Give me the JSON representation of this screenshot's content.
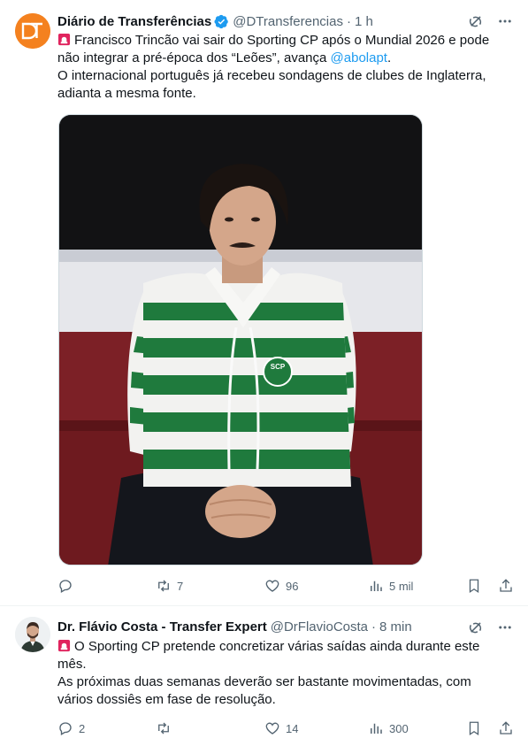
{
  "tweets": [
    {
      "author": {
        "display_name": "Diário de Transferências",
        "handle": "@DTransferencias",
        "verified": true,
        "avatar_text": "DT"
      },
      "time": "1 h",
      "text_parts": {
        "line1_before": "Francisco Trincão vai sair do Sporting CP após o Mundial 2026 e pode não integrar a pré-época dos “Leões”, avança ",
        "mention": "@abolapt",
        "line1_after": ".",
        "line2": "O internacional português já recebeu sondagens de clubes de Inglaterra, adianta a mesma fonte."
      },
      "media": {
        "crest_text": "SCP"
      },
      "stats": {
        "replies": "",
        "retweets": "7",
        "likes": "96",
        "views": "5 mil"
      }
    },
    {
      "author": {
        "display_name": "Dr. Flávio Costa - Transfer Expert",
        "handle": "@DrFlavioCosta",
        "verified": false
      },
      "time": "8 min",
      "text_parts": {
        "line1": "O Sporting CP pretende concretizar várias saídas ainda durante este mês.",
        "line2": "As próximas duas semanas deverão ser bastante movimentadas, com vários dossiês em fase de resolução."
      },
      "stats": {
        "replies": "2",
        "retweets": "",
        "likes": "14",
        "views": "300"
      }
    }
  ],
  "separator": "·",
  "colors": {
    "text_primary": "#0f1419",
    "text_secondary": "#536471",
    "link": "#1d9bf0",
    "verified": "#1d9bf0",
    "avatar_orange": "#f4811f",
    "sporting_green": "#1f7a3d"
  },
  "icons": {
    "grok": "grok-icon",
    "more": "more-icon",
    "siren": "siren-icon",
    "reply": "reply-icon",
    "retweet": "retweet-icon",
    "like": "heart-icon",
    "views": "views-icon",
    "bookmark": "bookmark-icon",
    "share": "share-icon"
  }
}
